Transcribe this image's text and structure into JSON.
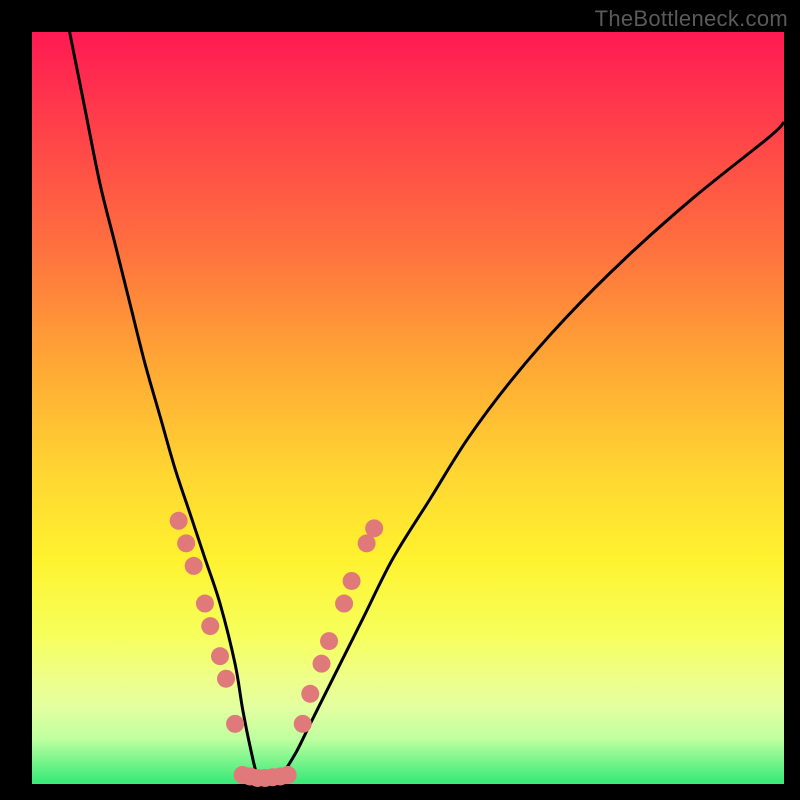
{
  "watermark": "TheBottleneck.com",
  "colors": {
    "background": "#000000",
    "gradient_top": "#FF1A53",
    "gradient_bottom": "#3EEB7A",
    "curve": "#000000",
    "marker_fill": "#E07A7A",
    "marker_stroke": "#C45E5E"
  },
  "chart_data": {
    "type": "line",
    "title": "",
    "xlabel": "",
    "ylabel": "",
    "xlim": [
      0,
      100
    ],
    "ylim": [
      0,
      100
    ],
    "axis_visible": false,
    "description": "V-shaped bottleneck curve over a vertical red-to-green gradient; bottom (green) is optimal, top (red) is worst. Curve minimum is near x≈30 at y≈0. Small salmon circular markers appear on both branches of the V only in the lower (good) band, roughly where y ≤ 35, plus a row along the very bottom near the minimum.",
    "series": [
      {
        "name": "bottleneck-curve",
        "x": [
          5,
          7,
          9,
          11,
          13,
          15,
          17,
          19,
          21,
          23,
          25,
          27,
          28,
          29,
          30,
          31,
          32,
          33,
          35,
          37,
          40,
          44,
          48,
          53,
          58,
          64,
          71,
          79,
          88,
          98,
          100
        ],
        "y": [
          100,
          90,
          80,
          72,
          64,
          56,
          49,
          42,
          36,
          30,
          24,
          16,
          10,
          5,
          1,
          0.5,
          0.5,
          1,
          4,
          8,
          14,
          22,
          30,
          38,
          46,
          54,
          62,
          70,
          78,
          86,
          88
        ]
      }
    ],
    "markers": [
      {
        "x": 19.5,
        "y": 35
      },
      {
        "x": 20.5,
        "y": 32
      },
      {
        "x": 21.5,
        "y": 29
      },
      {
        "x": 23.0,
        "y": 24
      },
      {
        "x": 23.7,
        "y": 21
      },
      {
        "x": 25.0,
        "y": 17
      },
      {
        "x": 25.8,
        "y": 14
      },
      {
        "x": 27.0,
        "y": 8
      },
      {
        "x": 28.0,
        "y": 1.2
      },
      {
        "x": 29.0,
        "y": 1.0
      },
      {
        "x": 30.0,
        "y": 0.8
      },
      {
        "x": 31.0,
        "y": 0.8
      },
      {
        "x": 32.0,
        "y": 0.9
      },
      {
        "x": 33.0,
        "y": 1.0
      },
      {
        "x": 34.0,
        "y": 1.2
      },
      {
        "x": 36.0,
        "y": 8
      },
      {
        "x": 37.0,
        "y": 12
      },
      {
        "x": 38.5,
        "y": 16
      },
      {
        "x": 39.5,
        "y": 19
      },
      {
        "x": 41.5,
        "y": 24
      },
      {
        "x": 42.5,
        "y": 27
      },
      {
        "x": 44.5,
        "y": 32
      },
      {
        "x": 45.5,
        "y": 34
      }
    ]
  }
}
